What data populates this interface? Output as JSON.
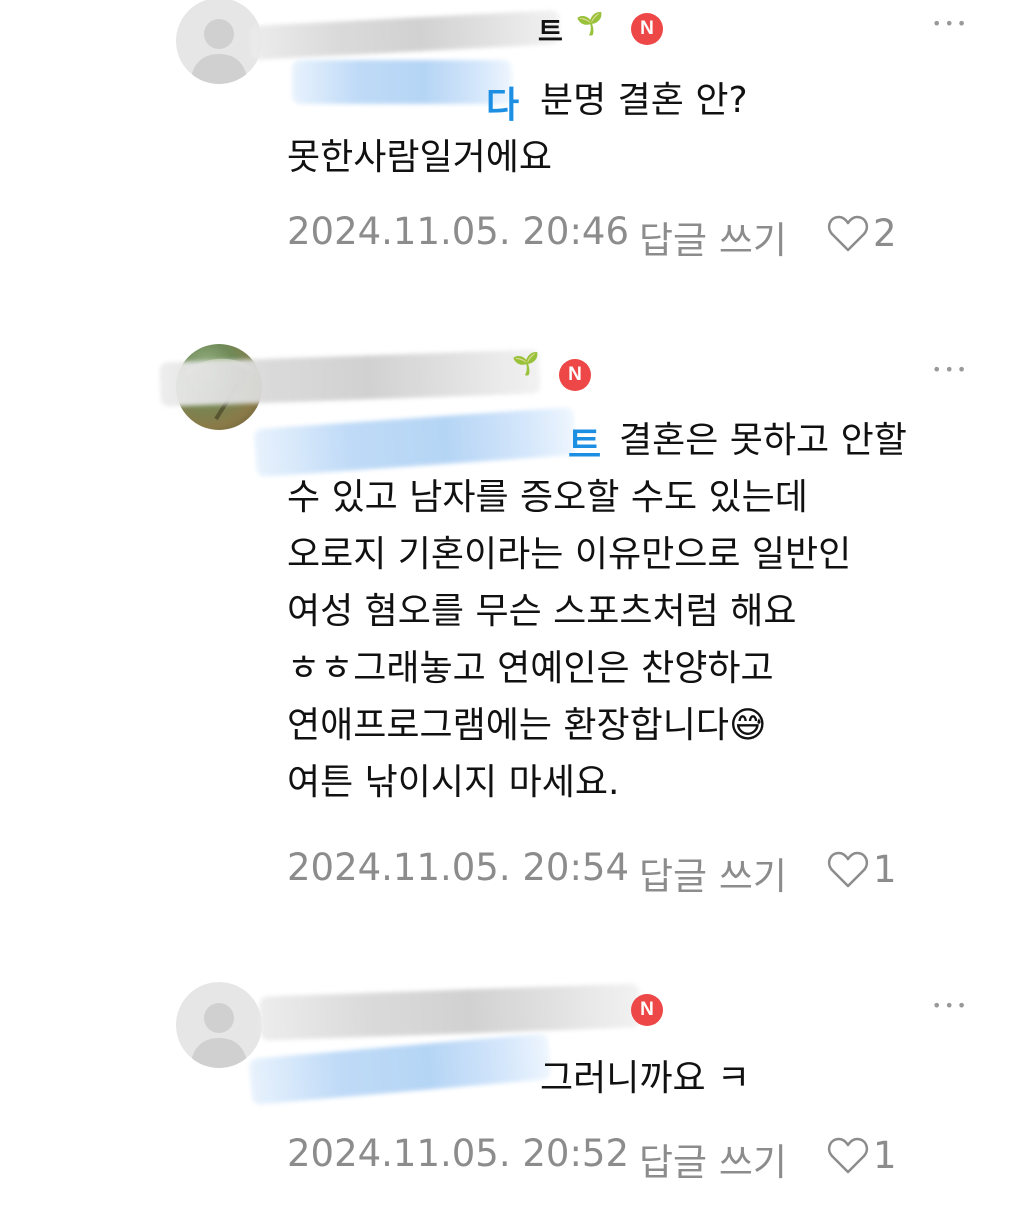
{
  "comments": [
    {
      "name_fragment": "트",
      "mention_fragment": "다",
      "text": "분명 결혼 안?\n못한사람일거에요",
      "time": "2024.11.05. 20:46",
      "reply_label": "답글 쓰기",
      "likes": "2",
      "badge": "N",
      "more": "•••"
    },
    {
      "name_fragment": "",
      "mention_fragment": "트",
      "text": "결혼은 못하고 안할\n수 있고 남자를 증오할 수도 있는데\n오로지 기혼이라는 이유만으로 일반인\n여성 혐오를 무슨 스포츠처럼 해요\nㅎㅎ그래놓고 연예인은 찬양하고\n연애프로그램에는 환장합니다😅\n여튼 낚이시지 마세요.",
      "time": "2024.11.05. 20:54",
      "reply_label": "답글 쓰기",
      "likes": "1",
      "badge": "N",
      "more": "•••"
    },
    {
      "name_fragment": "",
      "mention_fragment": "",
      "text": "그러니까요 ㅋ",
      "time": "2024.11.05. 20:52",
      "reply_label": "답글 쓰기",
      "likes": "1",
      "badge": "N",
      "more": "•••"
    }
  ],
  "colors": {
    "badge": "#ee4747",
    "mention": "#1d8fe3",
    "meta": "#8c8c8c",
    "sprout": "#4db32e"
  }
}
